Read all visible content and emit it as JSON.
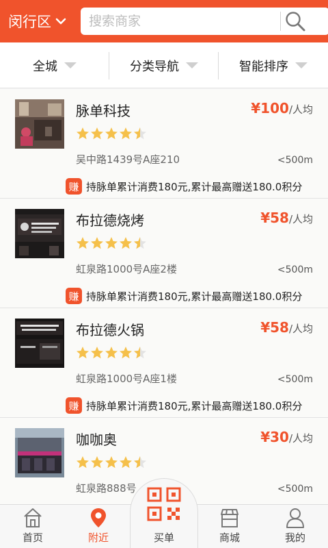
{
  "header": {
    "district": "闵行区",
    "search_placeholder": "搜索商家"
  },
  "filters": [
    "全城",
    "分类导航",
    "智能排序"
  ],
  "price_unit": "/人均",
  "promo_badge": "赚",
  "colors": {
    "accent": "#f0532c",
    "star": "#f5c04a"
  },
  "merchants": [
    {
      "name": "脉单科技",
      "price": "¥100",
      "rating": 4.5,
      "address": "吴中路1439号A座210",
      "distance": "<500m",
      "promo": "持脉单累计消费180元,累计最高赠送180.0积分"
    },
    {
      "name": "布拉德烧烤",
      "price": "¥58",
      "rating": 4.5,
      "address": "虹泉路1000号A座2楼",
      "distance": "<500m",
      "promo": "持脉单累计消费180元,累计最高赠送180.0积分"
    },
    {
      "name": "布拉德火锅",
      "price": "¥58",
      "rating": 4.5,
      "address": "虹泉路1000号A座1楼",
      "distance": "<500m",
      "promo": "持脉单累计消费180元,累计最高赠送180.0积分"
    },
    {
      "name": "咖咖奥",
      "price": "¥30",
      "rating": 4.5,
      "address": "虹泉路888号",
      "distance": "<500m",
      "promo": ""
    }
  ],
  "tabs": [
    {
      "label": "首页",
      "icon": "home-icon",
      "active": false
    },
    {
      "label": "附近",
      "icon": "location-pin-icon",
      "active": true
    },
    {
      "label": "买单",
      "icon": "qr-code-icon",
      "active": false
    },
    {
      "label": "商城",
      "icon": "store-icon",
      "active": false
    },
    {
      "label": "我的",
      "icon": "user-icon",
      "active": false
    }
  ]
}
